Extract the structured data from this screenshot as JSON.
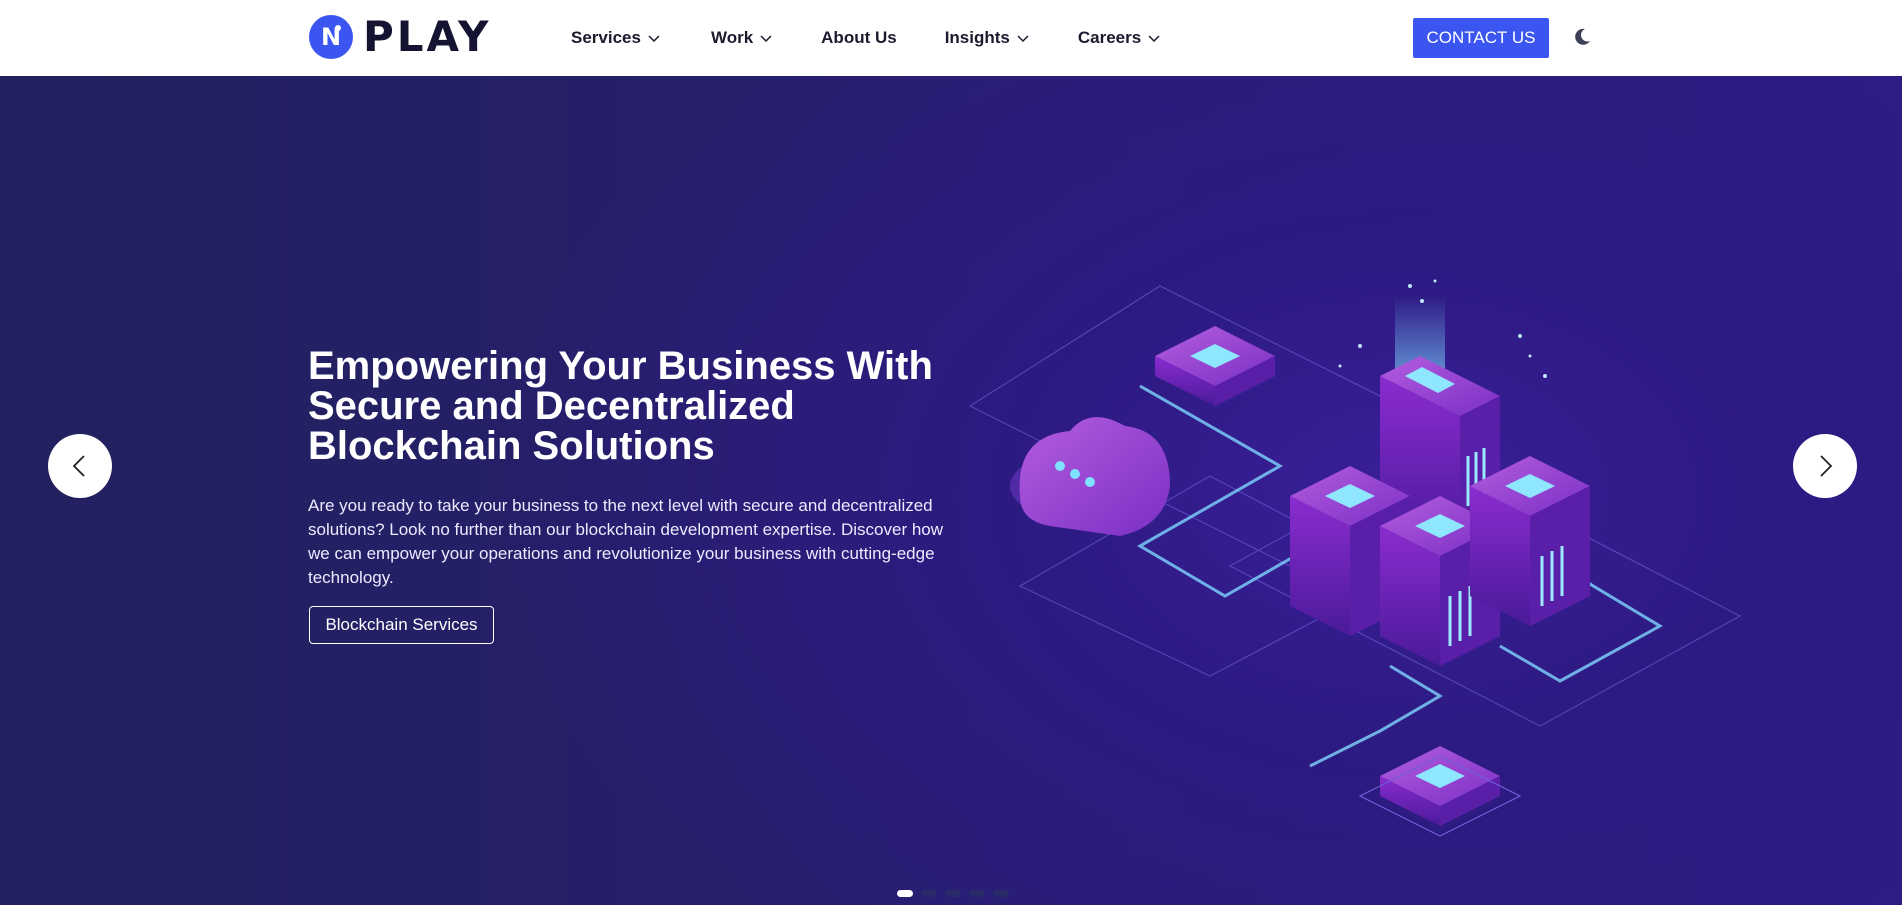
{
  "brand": {
    "logo_letter": "N",
    "logo_text": "PLAY"
  },
  "nav": {
    "items": [
      {
        "label": "Services",
        "has_dropdown": true
      },
      {
        "label": "Work",
        "has_dropdown": true
      },
      {
        "label": "About Us",
        "has_dropdown": false
      },
      {
        "label": "Insights",
        "has_dropdown": true
      },
      {
        "label": "Careers",
        "has_dropdown": true
      }
    ],
    "contact_label": "CONTACT US",
    "theme_toggle_icon": "moon-icon"
  },
  "hero": {
    "title_line1": "Empowering Your Business With",
    "title_line2": "Secure and Decentralized",
    "title_line3": "Blockchain Solutions",
    "description": "Are you ready to take your business to the next level with secure and decentralized solutions? Look no further than our blockchain development expertise. Discover how we can empower your operations and revolutionize your business with cutting-edge technology.",
    "cta_label": "Blockchain Services",
    "slides_total": 5,
    "active_slide": 1
  },
  "colors": {
    "accent": "#3a55f0",
    "hero_bg": "#261f6c",
    "text_dark": "#1b1b2e"
  }
}
